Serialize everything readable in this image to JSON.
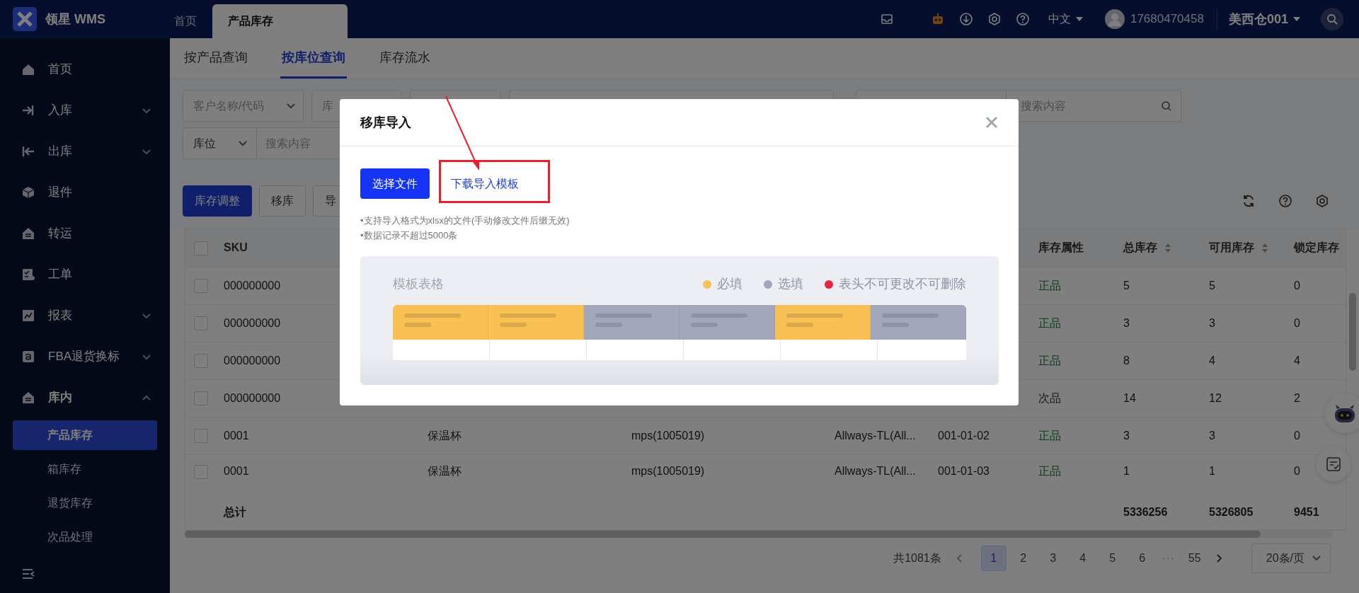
{
  "topbar": {
    "logo_text": "领星 WMS",
    "tabs": [
      {
        "label": "首页",
        "selected": false
      },
      {
        "label": "产品库存",
        "selected": true
      }
    ],
    "language": "中文",
    "username": "17680470458",
    "warehouse": "美西仓001"
  },
  "sidebar": {
    "items": [
      {
        "label": "首页"
      },
      {
        "label": "入库",
        "expanded": false
      },
      {
        "label": "出库",
        "expanded": false
      },
      {
        "label": "退件"
      },
      {
        "label": "转运"
      },
      {
        "label": "工单"
      },
      {
        "label": "报表",
        "expanded": false
      },
      {
        "label": "FBA退货换标",
        "expanded": false
      },
      {
        "label": "库内",
        "expanded": true,
        "children": [
          {
            "label": "产品库存",
            "selected": true
          },
          {
            "label": "箱库存",
            "selected": false
          },
          {
            "label": "退货库存",
            "selected": false
          },
          {
            "label": "次品处理",
            "selected": false
          }
        ]
      }
    ]
  },
  "page_tabs": [
    {
      "label": "按产品查询",
      "selected": false
    },
    {
      "label": "按库位查询",
      "selected": true
    },
    {
      "label": "库存流水",
      "selected": false
    }
  ],
  "filters": [
    [
      {
        "kind": "select",
        "placeholder": "客户名称/代码"
      },
      {
        "kind": "select",
        "placeholder": "库"
      },
      {
        "kind": "field"
      },
      {
        "kind": "field"
      },
      {
        "kind": "select_search",
        "placeholder": "搜索内容",
        "search_icon": true
      }
    ],
    [
      {
        "kind": "select_search",
        "select": "库位",
        "placeholder": "搜索内容"
      }
    ]
  ],
  "toolbar": {
    "buttons": [
      {
        "label": "库存调整",
        "kind": "primary"
      },
      {
        "label": "移库",
        "kind": "default"
      },
      {
        "label": "导",
        "kind": "default"
      }
    ]
  },
  "table": {
    "columns": [
      {
        "label": "SKU"
      },
      {},
      {},
      {},
      {},
      {
        "label": "库存属性"
      },
      {
        "label": "总库存",
        "sortable": true
      },
      {
        "label": "可用库存",
        "sortable": true
      },
      {
        "label": "锁定库存"
      }
    ],
    "header_checked": false,
    "rows": [
      {
        "checked": false,
        "cells": [
          "000000000",
          null,
          null,
          null,
          null
        ],
        "attribute": {
          "label": "正品",
          "kind": "good"
        },
        "stock": [
          "5",
          "5",
          "0"
        ]
      },
      {
        "checked": false,
        "cells": [
          "000000000",
          null,
          null,
          null,
          null
        ],
        "attribute": {
          "label": "正品",
          "kind": "good"
        },
        "stock": [
          "3",
          "3",
          "0"
        ]
      },
      {
        "checked": false,
        "cells": [
          "000000000",
          null,
          null,
          null,
          null
        ],
        "attribute": {
          "label": "正品",
          "kind": "good"
        },
        "stock": [
          "8",
          "4",
          "4"
        ]
      },
      {
        "checked": false,
        "cells": [
          "000000000",
          null,
          null,
          null,
          null
        ],
        "attribute": {
          "label": "次品",
          "kind": "defective"
        },
        "stock": [
          "14",
          "12",
          "2"
        ]
      },
      {
        "checked": false,
        "cells": [
          "0001",
          "保温杯",
          "mps(1005019)",
          "Allways-TL(All...",
          "001-01-02"
        ],
        "attribute": {
          "label": "正品",
          "kind": "good"
        },
        "stock": [
          "3",
          "3",
          "0"
        ]
      },
      {
        "checked": false,
        "cells": [
          "0001",
          "保温杯",
          "mps(1005019)",
          "Allways-TL(All...",
          "001-01-03"
        ],
        "attribute": {
          "label": "正品",
          "kind": "good"
        },
        "stock": [
          "1",
          "1",
          "0"
        ]
      }
    ],
    "total": {
      "label": "总计",
      "values": [
        "5336256",
        "5326805",
        "9451"
      ]
    }
  },
  "pagination": {
    "summary": "共1081条",
    "pages": [
      {
        "label": "1",
        "kind": "page",
        "selected": true
      },
      {
        "label": "2",
        "kind": "page",
        "selected": false
      },
      {
        "label": "3",
        "kind": "page",
        "selected": false
      },
      {
        "label": "4",
        "kind": "page",
        "selected": false
      },
      {
        "label": "5",
        "kind": "page",
        "selected": false
      },
      {
        "label": "6",
        "kind": "page",
        "selected": false
      },
      {
        "label": "···",
        "kind": "ellipsis",
        "selected": false
      },
      {
        "label": "55",
        "kind": "page",
        "selected": false
      }
    ],
    "page_size": "20条/页"
  },
  "dialog": {
    "title": "移库导入",
    "choose_button": "选择文件",
    "template_link": "下载导入模板",
    "notes": [
      "•支持导入格式为xlsx的文件(手动修改文件后缀无效)",
      "•数据记录不超过5000条"
    ],
    "template": {
      "title": "模板表格",
      "legend": [
        {
          "label": "必填",
          "color": "#f9c154"
        },
        {
          "label": "选填",
          "color": "#a3a6bd"
        },
        {
          "label": "表头不可更改不可删除",
          "color": "#e5243f"
        }
      ],
      "columns": [
        {
          "kind": "required"
        },
        {
          "kind": "required"
        },
        {
          "kind": "optional"
        },
        {
          "kind": "optional"
        },
        {
          "kind": "required"
        },
        {
          "kind": "optional"
        }
      ]
    }
  }
}
